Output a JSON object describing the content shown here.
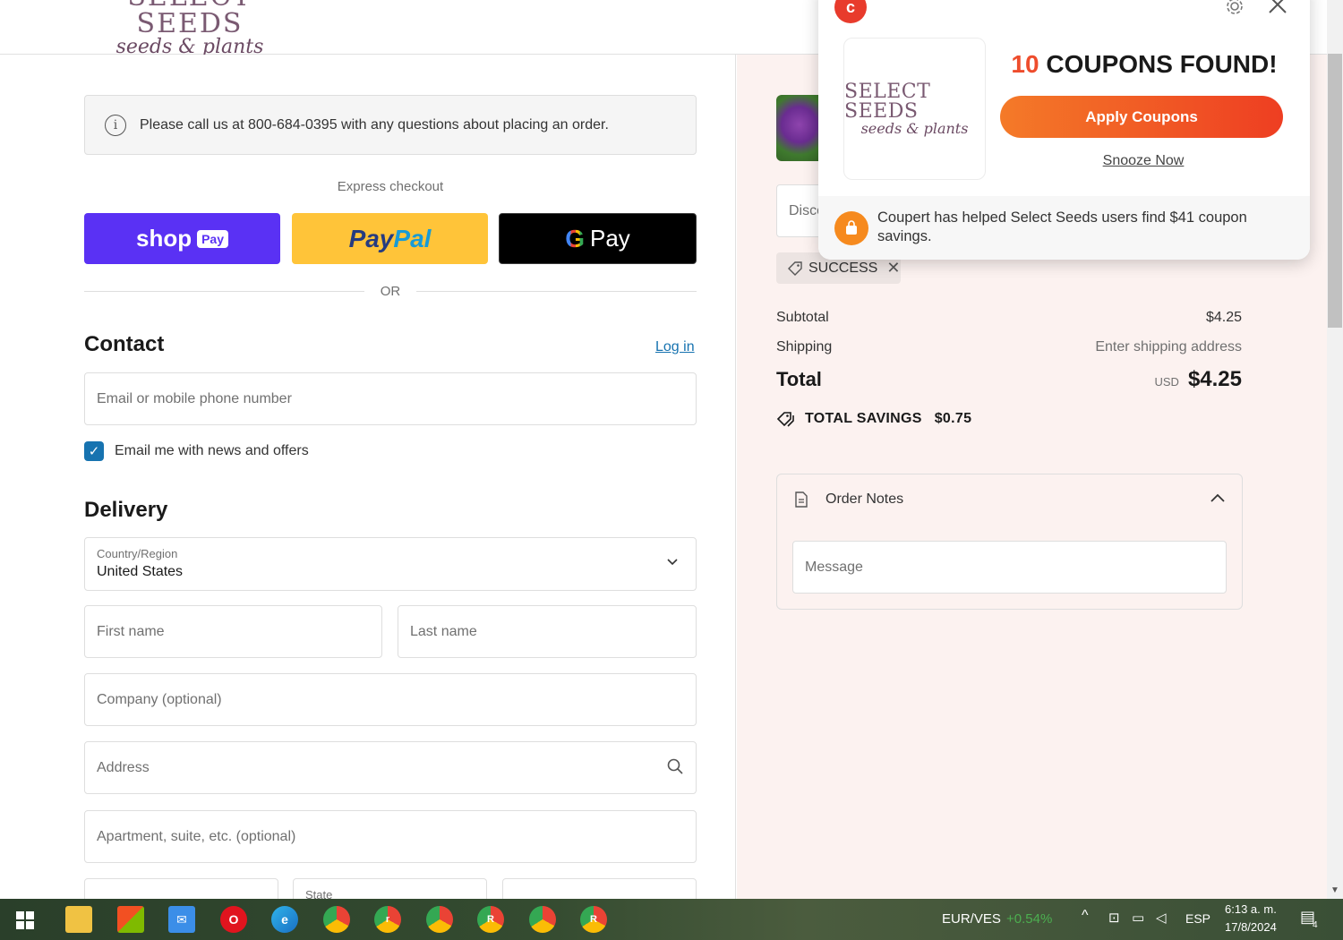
{
  "header": {
    "logo_line1": "SELECT SEEDS",
    "logo_line2": "seeds & plants"
  },
  "checkout": {
    "notice": "Please call us at 800-684-0395 with any questions about placing an order.",
    "express_label": "Express checkout",
    "shop_pay_label": "shop",
    "shop_pay_tag": "Pay",
    "paypal_part1": "Pay",
    "paypal_part2": "Pal",
    "gpay_g": "G",
    "gpay_label": "Pay",
    "or_label": "OR",
    "contact_title": "Contact",
    "login_label": "Log in",
    "email_placeholder": "Email or mobile phone number",
    "newsletter_label": "Email me with news and offers",
    "newsletter_checked": true,
    "delivery_title": "Delivery",
    "country_label": "Country/Region",
    "country_value": "United States",
    "first_name_placeholder": "First name",
    "last_name_placeholder": "Last name",
    "company_placeholder": "Company (optional)",
    "address_placeholder": "Address",
    "apartment_placeholder": "Apartment, suite, etc. (optional)",
    "state_label": "State"
  },
  "summary": {
    "discount_placeholder": "Disco",
    "applied_code": "SUCCESS",
    "subtotal_label": "Subtotal",
    "subtotal_value": "$4.25",
    "shipping_label": "Shipping",
    "shipping_value": "Enter shipping address",
    "total_label": "Total",
    "currency": "USD",
    "total_value": "$4.25",
    "savings_label": "TOTAL SAVINGS",
    "savings_value": "$0.75",
    "notes_title": "Order Notes",
    "message_placeholder": "Message"
  },
  "popup": {
    "store_line1": "SELECT SEEDS",
    "store_line2": "seeds & plants",
    "coupon_count": "10",
    "coupon_text": "COUPONS FOUND!",
    "apply_label": "Apply Coupons",
    "snooze_label": "Snooze Now",
    "footer_text": "Coupert has helped Select Seeds users find $41 coupon savings.",
    "brand_color": "#ee4d2d"
  },
  "taskbar": {
    "ticker": "EUR/VES",
    "ticker_change": "+0.54%",
    "lang": "ESP",
    "time": "6:13 a. m.",
    "date": "17/8/2024",
    "notif_count": "4",
    "chrome_badges": [
      "r",
      "R",
      "R"
    ]
  }
}
